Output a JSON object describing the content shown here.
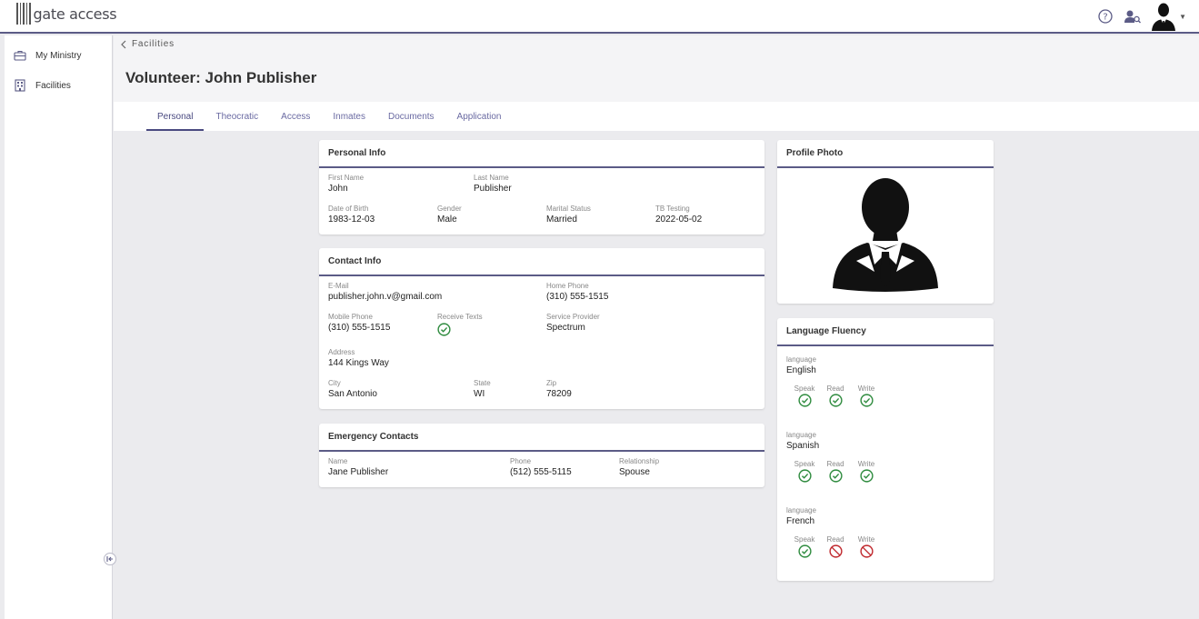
{
  "app": {
    "logo_text": "gate access"
  },
  "sidebar": {
    "items": [
      {
        "label": "My Ministry",
        "icon": "briefcase-icon"
      },
      {
        "label": "Facilities",
        "icon": "building-icon"
      }
    ]
  },
  "breadcrumb": {
    "label": "Facilities"
  },
  "page": {
    "title": "Volunteer: John Publisher"
  },
  "tabs": [
    {
      "label": "Personal",
      "active": true
    },
    {
      "label": "Theocratic"
    },
    {
      "label": "Access"
    },
    {
      "label": "Inmates"
    },
    {
      "label": "Documents"
    },
    {
      "label": "Application"
    }
  ],
  "personal_info": {
    "title": "Personal Info",
    "first_name": {
      "label": "First Name",
      "value": "John"
    },
    "last_name": {
      "label": "Last Name",
      "value": "Publisher"
    },
    "dob": {
      "label": "Date of Birth",
      "value": "1983-12-03"
    },
    "gender": {
      "label": "Gender",
      "value": "Male"
    },
    "marital": {
      "label": "Marital Status",
      "value": "Married"
    },
    "tb": {
      "label": "TB Testing",
      "value": "2022-05-02"
    }
  },
  "contact_info": {
    "title": "Contact Info",
    "email": {
      "label": "E-Mail",
      "value": "publisher.john.v@gmail.com"
    },
    "home_phone": {
      "label": "Home Phone",
      "value": "(310) 555-1515"
    },
    "mobile_phone": {
      "label": "Mobile Phone",
      "value": "(310) 555-1515"
    },
    "receive_texts": {
      "label": "Receive Texts",
      "value": true
    },
    "provider": {
      "label": "Service Provider",
      "value": "Spectrum"
    },
    "address": {
      "label": "Address",
      "value": "144 Kings Way"
    },
    "city": {
      "label": "City",
      "value": "San Antonio"
    },
    "state": {
      "label": "State",
      "value": "WI"
    },
    "zip": {
      "label": "Zip",
      "value": "78209"
    }
  },
  "emergency": {
    "title": "Emergency Contacts",
    "name": {
      "label": "Name",
      "value": "Jane Publisher"
    },
    "phone": {
      "label": "Phone",
      "value": "(512) 555-5115"
    },
    "relationship": {
      "label": "Relationship",
      "value": "Spouse"
    }
  },
  "profile_photo": {
    "title": "Profile Photo"
  },
  "language_fluency": {
    "title": "Language Fluency",
    "field_label": "language",
    "skill_labels": {
      "speak": "Speak",
      "read": "Read",
      "write": "Write"
    },
    "languages": [
      {
        "name": "English",
        "speak": true,
        "read": true,
        "write": true
      },
      {
        "name": "Spanish",
        "speak": true,
        "read": true,
        "write": true
      },
      {
        "name": "French",
        "speak": true,
        "read": false,
        "write": false
      }
    ]
  },
  "colors": {
    "accent": "#5b5b86",
    "ok": "#2e8b3e",
    "no": "#c0282d",
    "tab": "#6a6aa2"
  }
}
